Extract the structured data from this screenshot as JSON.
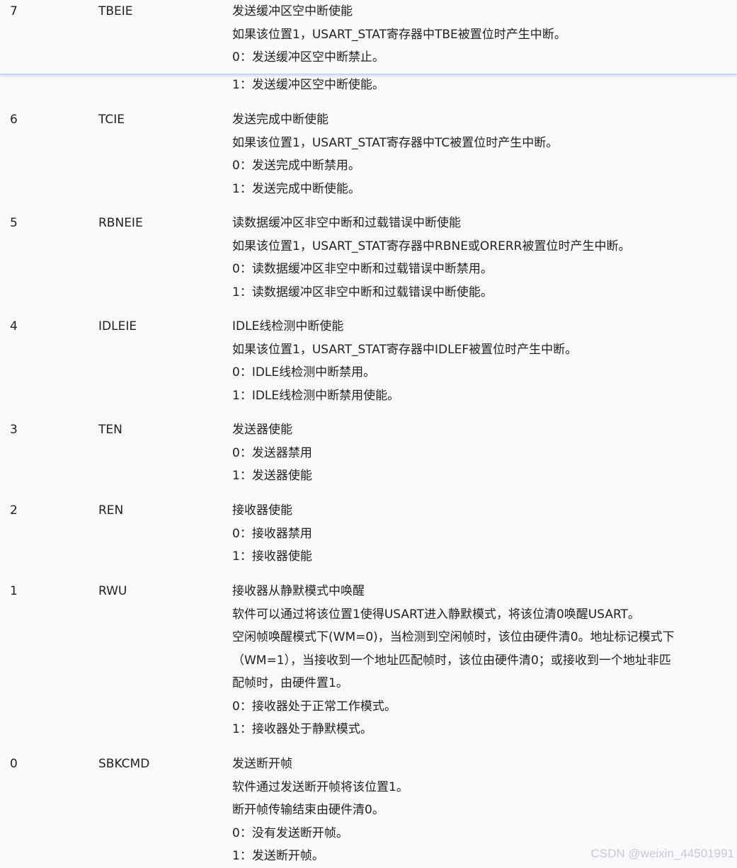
{
  "rows": [
    {
      "bit": "7",
      "field": "TBEIE",
      "lines": [
        "发送缓冲区空中断使能",
        "如果该位置1，USART_STAT寄存器中TBE被置位时产生中断。",
        "0：发送缓冲区空中断禁止。",
        "1：发送缓冲区空中断使能。"
      ]
    },
    {
      "bit": "6",
      "field": "TCIE",
      "lines": [
        "发送完成中断使能",
        "如果该位置1，USART_STAT寄存器中TC被置位时产生中断。",
        "0：发送完成中断禁用。",
        "1：发送完成中断使能。"
      ]
    },
    {
      "bit": "5",
      "field": "RBNEIE",
      "lines": [
        "读数据缓冲区非空中断和过载错误中断使能",
        "如果该位置1，USART_STAT寄存器中RBNE或ORERR被置位时产生中断。",
        "0：读数据缓冲区非空中断和过载错误中断禁用。",
        "1：读数据缓冲区非空中断和过载错误中断使能。"
      ]
    },
    {
      "bit": "4",
      "field": "IDLEIE",
      "lines": [
        "IDLE线检测中断使能",
        "如果该位置1，USART_STAT寄存器中IDLEF被置位时产生中断。",
        "0：IDLE线检测中断禁用。",
        "1：IDLE线检测中断禁用使能。"
      ]
    },
    {
      "bit": "3",
      "field": "TEN",
      "lines": [
        "发送器使能",
        "0：发送器禁用",
        "1：发送器使能"
      ]
    },
    {
      "bit": "2",
      "field": "REN",
      "lines": [
        "接收器使能",
        "0：接收器禁用",
        "1：接收器使能"
      ]
    },
    {
      "bit": "1",
      "field": "RWU",
      "lines": [
        "接收器从静默模式中唤醒",
        "软件可以通过将该位置1使得USART进入静默模式，将该位清0唤醒USART。",
        "空闲帧唤醒模式下(WM=0)，当检测到空闲帧时，该位由硬件清0。地址标记模式下",
        "（WM=1），当接收到一个地址匹配帧时，该位由硬件清0；或接收到一个地址非匹",
        "配帧时，由硬件置1。",
        "0：接收器处于正常工作模式。",
        "1：接收器处于静默模式。"
      ]
    },
    {
      "bit": "0",
      "field": "SBKCMD",
      "lines": [
        "发送断开帧",
        "软件通过发送断开帧将该位置1。",
        "断开帧传输结束由硬件清0。",
        "0：没有发送断开帧。",
        "1：发送断开帧。"
      ]
    }
  ],
  "watermark": "CSDN @weixin_44501991"
}
